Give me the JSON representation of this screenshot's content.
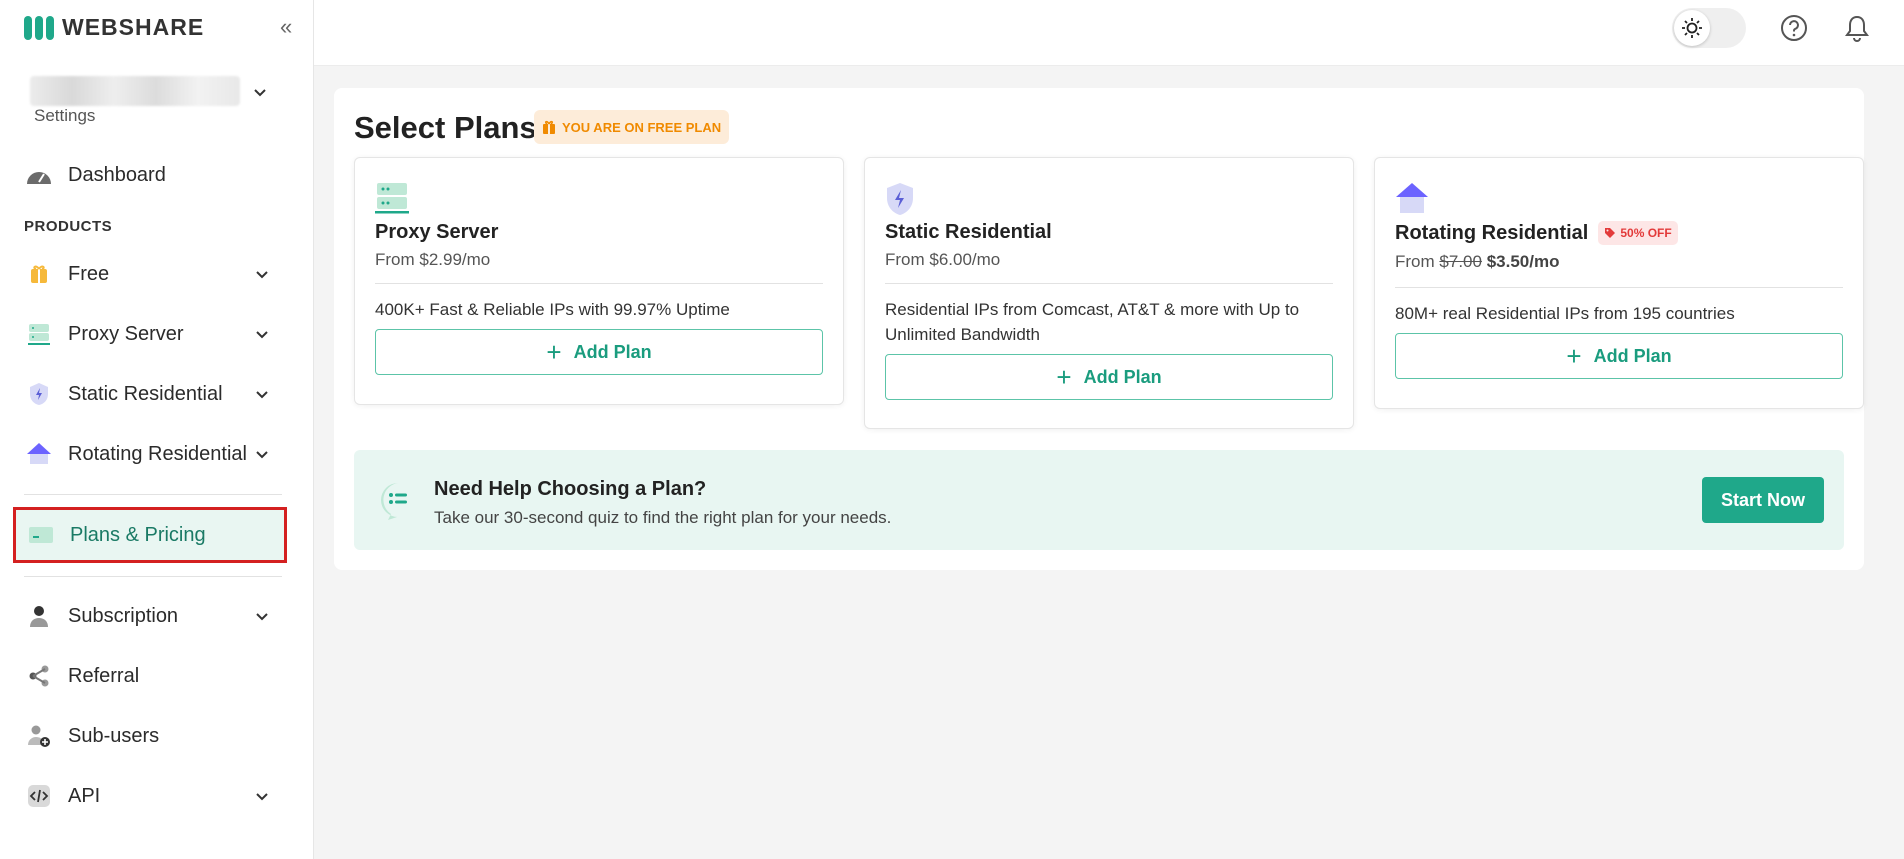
{
  "brand": {
    "name": "WEBSHARE"
  },
  "account": {
    "settings_label": "Settings"
  },
  "sidebar": {
    "dashboard": "Dashboard",
    "products_heading": "PRODUCTS",
    "items": [
      {
        "label": "Free"
      },
      {
        "label": "Proxy Server"
      },
      {
        "label": "Static Residential"
      },
      {
        "label": "Rotating Residential"
      }
    ],
    "plans_pricing": "Plans & Pricing",
    "subscription": "Subscription",
    "referral": "Referral",
    "subusers": "Sub-users",
    "api": "API"
  },
  "main": {
    "title": "Select Plans",
    "plan_badge": "YOU ARE ON FREE PLAN",
    "cards": [
      {
        "title": "Proxy Server",
        "price": "From $2.99/mo",
        "description": "400K+ Fast & Reliable IPs with 99.97% Uptime",
        "button": "Add Plan"
      },
      {
        "title": "Static Residential",
        "price": "From $6.00/mo",
        "description": "Residential IPs from Comcast, AT&T & more with Up to Unlimited Bandwidth",
        "button": "Add Plan"
      },
      {
        "title": "Rotating Residential",
        "badge": "50% OFF",
        "price_prefix": "From",
        "old_price": "$7.00",
        "new_price": "$3.50/mo",
        "description": "80M+ real Residential IPs from 195 countries",
        "button": "Add Plan"
      }
    ],
    "help": {
      "title": "Need Help Choosing a Plan?",
      "subtitle": "Take our 30-second quiz to find the right plan for your needs.",
      "button": "Start Now"
    }
  },
  "colors": {
    "accent": "#1fa88a",
    "active_outline": "#d42020",
    "badge_orange": "#f08a00",
    "badge_red": "#e33a3a"
  }
}
